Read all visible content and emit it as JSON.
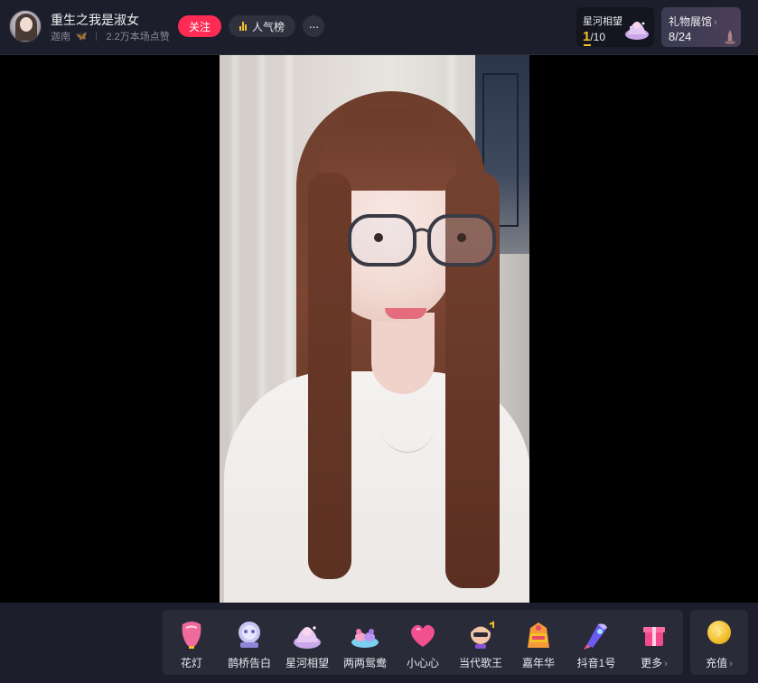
{
  "header": {
    "streamer_name": "重生之我是淑女",
    "location": "迦南",
    "likes_text": "2.2万本场点赞",
    "follow_label": "关注",
    "rank_label": "人气榜",
    "more_label": "···",
    "galaxy": {
      "title": "星河相望",
      "progress_current": "1",
      "progress_total": "/10"
    },
    "museum": {
      "title": "礼物展馆",
      "chevron": "›",
      "count": "8/24"
    }
  },
  "gifts": {
    "items": [
      {
        "label": "花灯",
        "icon": "sky-lantern-icon"
      },
      {
        "label": "鹊桥告白",
        "icon": "magpie-bridge-icon"
      },
      {
        "label": "星河相望",
        "icon": "galaxy-icon"
      },
      {
        "label": "两两鸳鸯",
        "icon": "mandarin-duck-icon"
      },
      {
        "label": "小心心",
        "icon": "heart-icon"
      },
      {
        "label": "当代歌王",
        "icon": "singer-icon"
      },
      {
        "label": "嘉年华",
        "icon": "carnival-icon"
      },
      {
        "label": "抖音1号",
        "icon": "rocket-icon"
      }
    ],
    "more_label": "更多",
    "more_chevron": "›",
    "recharge_label": "充值",
    "recharge_chevron": "›"
  },
  "colors": {
    "accent": "#fe2c55",
    "gold": "#f5c024",
    "panel": "#2a2b39",
    "bar": "#1d1e2b"
  }
}
